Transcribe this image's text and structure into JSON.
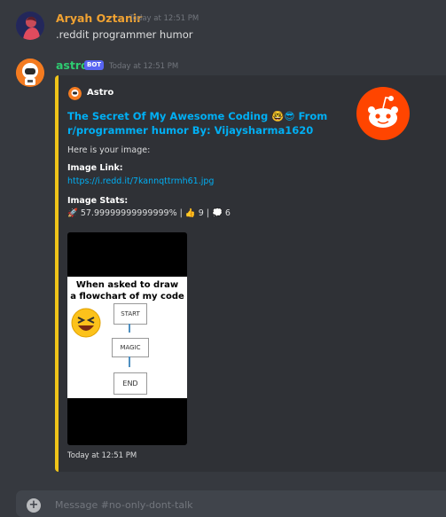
{
  "messages": [
    {
      "username": "Aryah Oztanir",
      "username_color": "#f0a232",
      "timestamp": "Today at 12:51 PM",
      "text": ".reddit programmer humor"
    },
    {
      "username": "astro",
      "username_color": "#2ecc71",
      "bot_badge": "BOT",
      "timestamp": "Today at 12:51 PM",
      "embed": {
        "accent_color": "#f0c419",
        "author": "Astro",
        "title_line1": "The Secret Of My Awesome Coding 🤓😎 From",
        "title_line2": "r/programmer humor By: Vijaysharma1620",
        "description": "Here is your image:",
        "image_link_label": "Image Link:",
        "image_link": "https://i.redd.it/7kannqttrmh61.jpg",
        "stats_label": "Image Stats:",
        "stats": "🚀 57.99999999999999% | 👍 9 | 💭 6",
        "meme": {
          "caption_line1": "When asked to draw",
          "caption_line2": "a flowchart of my code",
          "box_start": "START",
          "box_magic": "MAGIC",
          "box_end": "END"
        },
        "footer_timestamp": "Today at 12:51 PM"
      }
    }
  ],
  "input": {
    "placeholder": "Message #no-only-dont-talk"
  }
}
